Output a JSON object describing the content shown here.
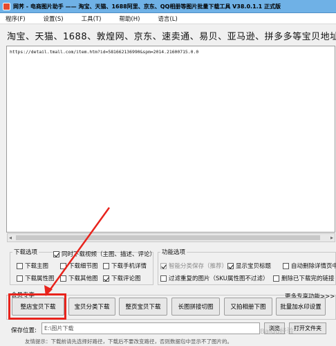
{
  "window": {
    "title": "网荠 - 电商图片助手 —— 淘宝、天猫、1688阿里、京东、QQ相册等图片批量下载工具 V38.0.1.1 正式版"
  },
  "menu": [
    "程序(F)",
    "设置(S)",
    "工具(T)",
    "帮助(H)",
    "语言(L)"
  ],
  "url_label": "淘宝、天猫、1688、敦煌网、京东、速卖通、易贝、亚马逊、拼多多等宝贝地址:",
  "url_text": "https://detail.tmall.com/item.htm?id=581662136990&spm=2014.21600715.0.0",
  "download_options": {
    "title": "下载选项",
    "items": [
      {
        "label": "同时下载视频（主图、描述、评论）",
        "checked": true
      },
      {
        "label": "下载主图",
        "checked": false
      },
      {
        "label": "下载细节图",
        "checked": false
      },
      {
        "label": "下载手机详情",
        "checked": false
      },
      {
        "label": "下载属性图",
        "checked": false
      },
      {
        "label": "下载其他图",
        "checked": false
      },
      {
        "label": "下载评论图",
        "checked": true
      }
    ]
  },
  "function_options": {
    "title": "功能选项",
    "items": [
      {
        "label": "智能分类保存（推荐）",
        "checked": true,
        "disabled": true
      },
      {
        "label": "显示宝贝标题",
        "checked": true,
        "disabled": false
      },
      {
        "label": "自动删除详情页中",
        "checked": false,
        "disabled": false
      },
      {
        "label": "过滤重复的图片（SKU属性图不过滤）",
        "checked": false,
        "disabled": false
      },
      {
        "label": "删除已下载完的链接",
        "checked": false,
        "disabled": false
      }
    ]
  },
  "member": {
    "title": "会员专享",
    "more": "更多专享功能>>>",
    "buttons": [
      "整店宝贝下载",
      "宝贝分类下载",
      "整页宝贝下载",
      "长图拼接切图",
      "又拍相册下图",
      "批量加水印设置"
    ]
  },
  "save": {
    "label": "保存位置:",
    "value": "E:\\图片下载",
    "browse": "浏览",
    "open": "打开文件夹"
  },
  "hint": "友情提示：下载前请先选择好路径，下载后不要改变路径，否则数据包中显示不了图片的。",
  "watermark": "Baidu经验"
}
